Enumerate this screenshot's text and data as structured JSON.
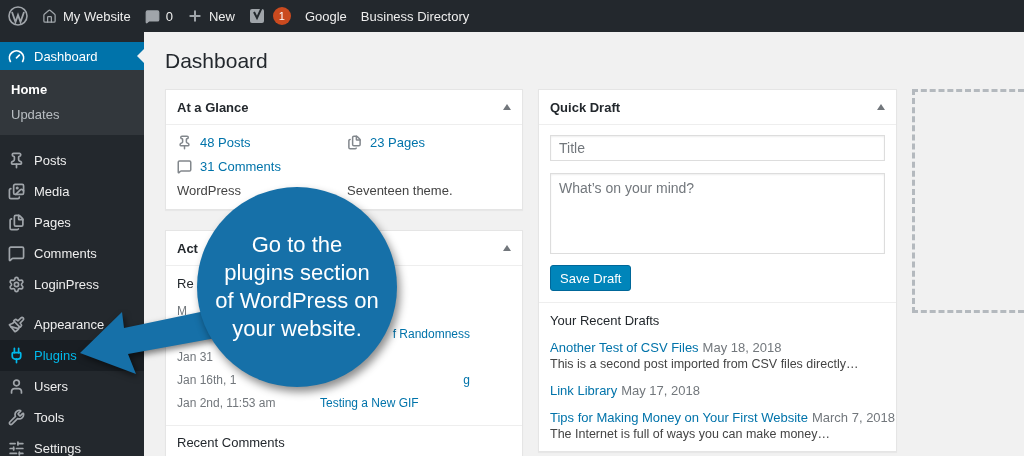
{
  "admin_bar": {
    "site": "My Website",
    "comments": "0",
    "new": "New",
    "notifications": "1",
    "links": [
      "Google",
      "Business Directory"
    ]
  },
  "sidebar": {
    "items": [
      {
        "label": "Dashboard",
        "selected": true,
        "hover": false,
        "children": [
          {
            "label": "Home",
            "selected": true
          },
          {
            "label": "Updates",
            "selected": false
          }
        ]
      },
      {
        "label": "Posts",
        "selected": false,
        "hover": false
      },
      {
        "label": "Media",
        "selected": false,
        "hover": false
      },
      {
        "label": "Pages",
        "selected": false,
        "hover": false
      },
      {
        "label": "Comments",
        "selected": false,
        "hover": false
      },
      {
        "label": "LoginPress",
        "selected": false,
        "hover": false
      },
      {
        "label": "Appearance",
        "selected": false,
        "hover": false
      },
      {
        "label": "Plugins",
        "selected": false,
        "hover": true
      },
      {
        "label": "Users",
        "selected": false,
        "hover": false
      },
      {
        "label": "Tools",
        "selected": false,
        "hover": false
      },
      {
        "label": "Settings",
        "selected": false,
        "hover": false
      }
    ]
  },
  "page_title": "Dashboard",
  "at_a_glance": {
    "title": "At a Glance",
    "items": [
      {
        "label": "48 Posts"
      },
      {
        "label": "23 Pages"
      },
      {
        "label": "31 Comments"
      }
    ],
    "note": [
      "WordPress",
      "Seventeen theme."
    ]
  },
  "activity": {
    "title": "Act",
    "heading": "Re",
    "rows": [
      {
        "date": "M"
      },
      {
        "title": "f Randomness",
        "cut_before": true
      },
      {
        "date": "Jan 31"
      },
      {
        "date": "Jan 16th, 1",
        "title": "g",
        "cut_before": true
      },
      {
        "date": "Jan 2nd, 11:53 am",
        "title": "Testing a New GIF",
        "cut_before": false
      }
    ],
    "recent_comments": "Recent Comments"
  },
  "quick_draft": {
    "title": "Quick Draft",
    "title_placeholder": "Title",
    "content_placeholder": "What’s on your mind?",
    "button": "Save Draft",
    "drafts_heading": "Your Recent Drafts",
    "drafts": [
      {
        "title": "Another Test of CSV Files",
        "date": "May 18, 2018",
        "excerpt": "This is a second post imported from CSV files directly…"
      },
      {
        "title": "Link Library",
        "date": "May 17, 2018"
      },
      {
        "title": "Tips for Making Money on Your First Website",
        "date": "March 7, 2018",
        "excerpt": "The Internet is full of ways you can make money…"
      }
    ]
  },
  "callout": {
    "lines": [
      "Go to the",
      "plugins section",
      "of WordPress on",
      "your website."
    ]
  }
}
